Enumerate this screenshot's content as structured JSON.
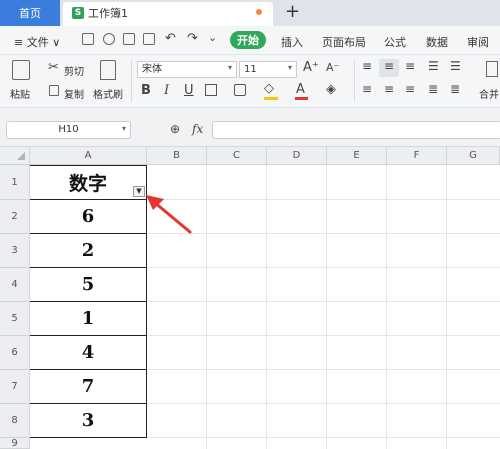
{
  "tabs": {
    "home_label": "首页",
    "doc_icon": "S",
    "doc_title": "工作簿1",
    "add_label": "+"
  },
  "menu": {
    "file_label": "≡ 文件 ∨",
    "items": [
      "开始",
      "插入",
      "页面布局",
      "公式",
      "数据",
      "审阅"
    ]
  },
  "ribbon": {
    "paste_label": "粘贴",
    "cut_label": "剪切",
    "copy_label": "复制",
    "format_painter_label": "格式刷",
    "font_name": "宋体",
    "font_size": "11",
    "merge_label": "合并"
  },
  "formula_bar": {
    "cell_ref": "H10",
    "fx_label": "fx",
    "value": ""
  },
  "sheet": {
    "columns": [
      "A",
      "B",
      "C",
      "D",
      "E",
      "F",
      "G"
    ],
    "rows": [
      "1",
      "2",
      "3",
      "4",
      "5",
      "6",
      "7",
      "8",
      "9"
    ],
    "header_text": "数字",
    "values": [
      "6",
      "2",
      "5",
      "1",
      "4",
      "7",
      "3"
    ]
  },
  "colors": {
    "accent_blue": "#3b7ddd",
    "start_green": "#2fa85a",
    "arrow_red": "#e8342a"
  }
}
